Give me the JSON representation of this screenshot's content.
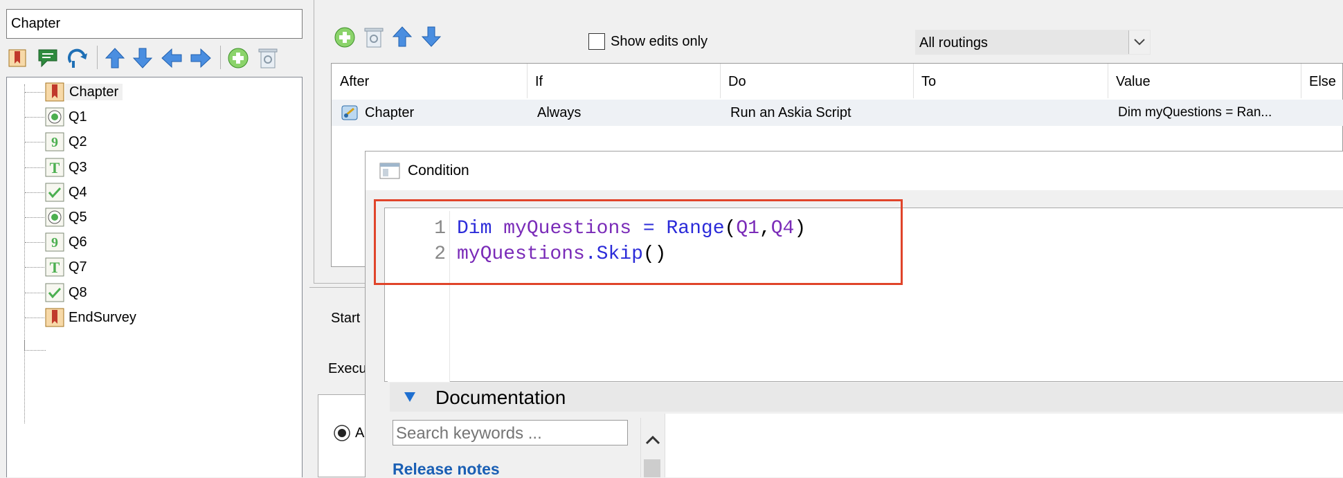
{
  "left_panel": {
    "chapter_input_value": "Chapter",
    "toolbar_icons": [
      "chapter-icon",
      "comment-icon",
      "loop-icon",
      "arrow-up-icon",
      "arrow-down-icon",
      "arrow-left-icon",
      "arrow-right-icon",
      "add-icon",
      "delete-icon"
    ],
    "tree": [
      {
        "label": "Chapter",
        "type": "chapter"
      },
      {
        "label": "Q1",
        "type": "single"
      },
      {
        "label": "Q2",
        "type": "numeric"
      },
      {
        "label": "Q3",
        "type": "open"
      },
      {
        "label": "Q4",
        "type": "multiple"
      },
      {
        "label": "Q5",
        "type": "single"
      },
      {
        "label": "Q6",
        "type": "numeric"
      },
      {
        "label": "Q7",
        "type": "open"
      },
      {
        "label": "Q8",
        "type": "multiple"
      },
      {
        "label": "EndSurvey",
        "type": "chapter"
      }
    ]
  },
  "routing_toolbar": {
    "show_edits_label": "Show edits only",
    "routing_select_value": "All routings"
  },
  "grid": {
    "columns": [
      "After",
      "If",
      "Do",
      "To",
      "Value",
      "Else"
    ],
    "rows": [
      {
        "after": "Chapter",
        "if": "Always",
        "do": "Run an Askia Script",
        "to": "",
        "value": "Dim myQuestions = Ran..."
      }
    ]
  },
  "lower_panel": {
    "start_label": "Start",
    "execute_label": "Execu",
    "option_label": "A"
  },
  "dialog": {
    "title": "Condition",
    "code_lines": [
      {
        "num": "1"
      },
      {
        "num": "2"
      }
    ],
    "code": {
      "l1_dim": "Dim",
      "l1_var": "myQuestions",
      "l1_eq": " = ",
      "l1_fn": "Range",
      "l1_open": "(",
      "l1_a": "Q1",
      "l1_comma": ",",
      "l1_b": "Q4",
      "l1_close": ")",
      "l2_var": "myQuestions",
      "l2_dot": ".",
      "l2_fn": "Skip",
      "l2_paren": "()"
    },
    "documentation": {
      "header": "Documentation",
      "search_placeholder": "Search keywords ...",
      "link": "Release notes"
    }
  },
  "colors": {
    "keyword": "#2b2bd9",
    "variable": "#7a2bb8",
    "highlight": "#e0442a",
    "link": "#1a5fb4"
  }
}
